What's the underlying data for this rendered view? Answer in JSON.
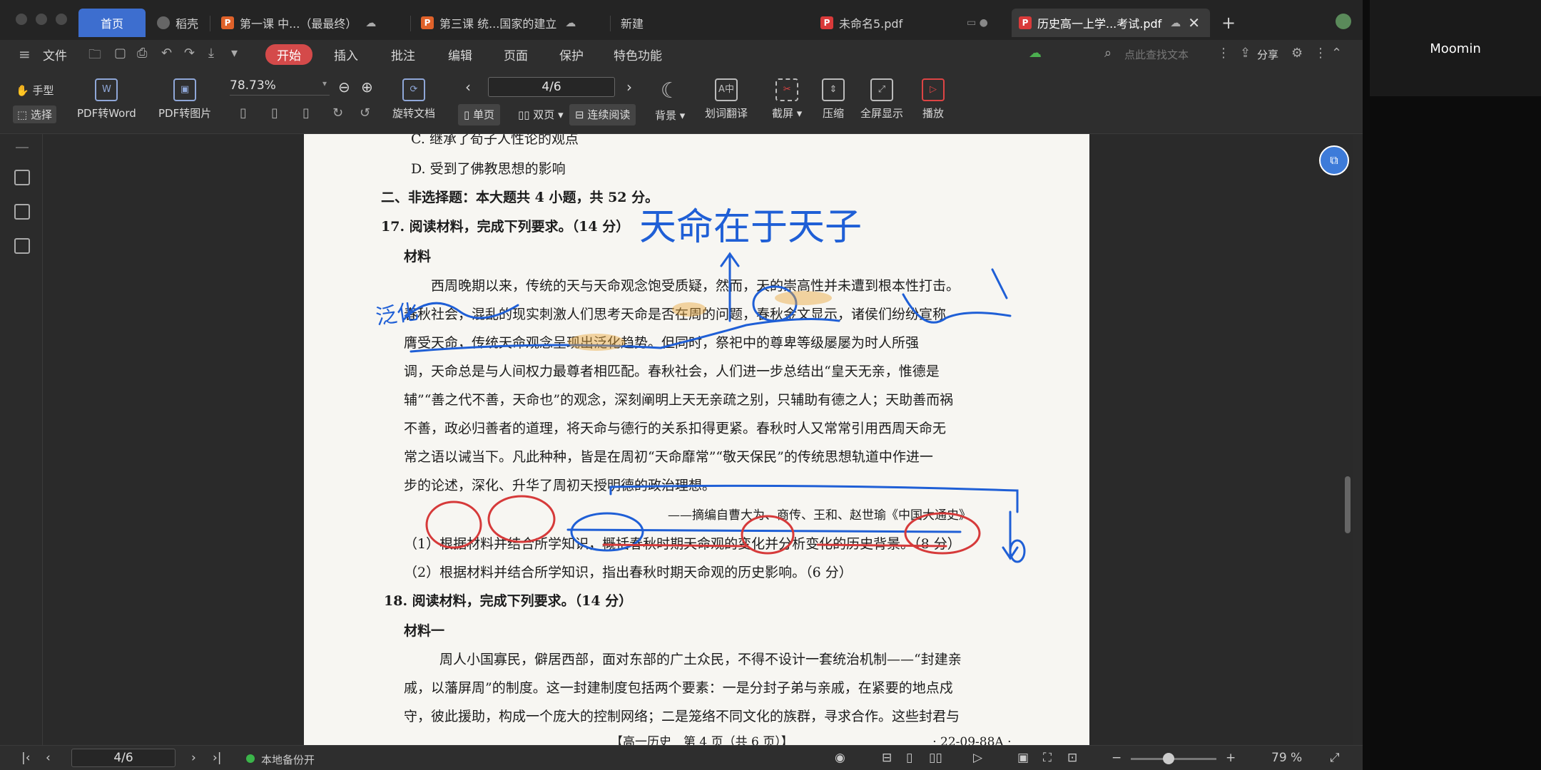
{
  "tabs": {
    "home": "首页",
    "daoke": "稻壳",
    "doc1": "第一课 中...（最最终）",
    "doc2": "第三课 统...国家的建立",
    "new_tab": "新建",
    "pdf1": "未命名5.pdf",
    "pdf2": "历史高一上学...考试.pdf",
    "add": "+"
  },
  "menu": {
    "file": "文件",
    "start": "开始",
    "insert": "插入",
    "annotate": "批注",
    "edit": "编辑",
    "page": "页面",
    "protect": "保护",
    "features": "特色功能",
    "search_placeholder": "点此查找文本",
    "share": "分享"
  },
  "toolbar": {
    "hand": "手型",
    "select": "选择",
    "pdf_to_word": "PDF转Word",
    "pdf_to_image": "PDF转图片",
    "zoom": "78.73%",
    "rotate": "旋转文档",
    "page_indicator": "4/6",
    "single": "单页",
    "double": "双页",
    "continuous": "连续阅读",
    "background": "背景",
    "translate": "划词翻译",
    "screenshot": "截屏",
    "compress": "压缩",
    "fullscreen": "全屏显示",
    "play": "播放"
  },
  "document": {
    "lines": [
      "C. 继承了荀子人性论的观点",
      "D. 受到了佛教思想的影响",
      "二、非选择题：本大题共 4 小题，共 52 分。",
      "17. 阅读材料，完成下列要求。（14 分）",
      "材料",
      "西周晚期以来，传统的天与天命观念饱受质疑，然而，天的崇高性并未遭到根本性打击。",
      "春秋社会，混乱的现实刺激人们思考天命是否在周的问题，春秋金文显示，诸侯们纷纷宣称",
      "膺受天命，传统天命观念呈现出泛化趋势。但同时，祭祀中的尊卑等级屡屡为时人所强",
      "调，天命总是与人间权力最尊者相匹配。春秋社会，人们进一步总结出“皇天无亲，惟德是",
      "辅”“善之代不善，天命也”的观念，深刻阐明上天无亲疏之别，只辅助有德之人；天助善而祸",
      "不善，政必归善者的道理，将天命与德行的关系扣得更紧。春秋时人又常常引用西周天命无",
      "常之语以诫当下。凡此种种，皆是在周初“天命靡常”“敬天保民”的传统思想轨道中作进一",
      "步的论述，深化、升华了周初天授明德的政治理想。",
      "——摘编自曹大为、商传、王和、赵世瑜《中国大通史》",
      "（1）根据材料并结合所学知识，概括春秋时期天命观的变化并分析变化的历史背景。（8 分）",
      "（2）根据材料并结合所学知识，指出春秋时期天命观的历史影响。（6 分）",
      "18. 阅读材料，完成下列要求。（14 分）",
      "材料一",
      "周人小国寡民，僻居西部，面对东部的广土众民，不得不设计一套统治机制——“封建亲",
      "戚，以藩屏周”的制度。这一封建制度包括两个要素：一是分封子弟与亲戚，在紧要的地点戍",
      "守，彼此援助，构成一个庞大的控制网络；二是笼络不同文化的族群，寻求合作。这些封君与",
      "【高一历史　第 4 页（共 6 页）】　　　　　　　　　　　　· 22-09-88A ·"
    ],
    "handwriting": "天命在于天子",
    "handwriting_left": "泛化"
  },
  "status": {
    "page": "4/6",
    "backup": "本地备份开",
    "zoom": "79 %"
  },
  "participant": "Moomin"
}
